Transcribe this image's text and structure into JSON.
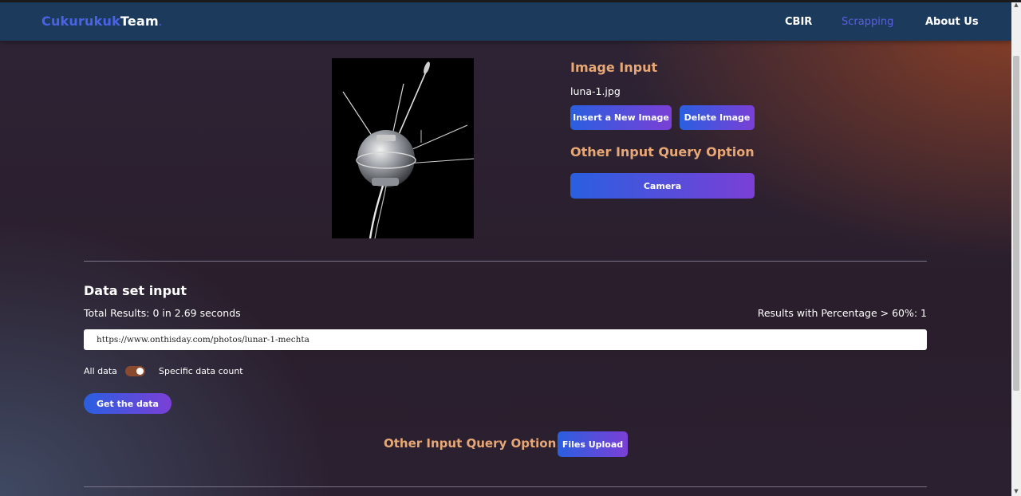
{
  "nav": {
    "brand_part1": "Cukurukuk",
    "brand_part2": "Team",
    "brand_dot": ".",
    "links": [
      {
        "label": "CBIR",
        "active": false
      },
      {
        "label": "Scrapping",
        "active": true
      },
      {
        "label": "About Us",
        "active": false
      }
    ]
  },
  "image_input": {
    "title": "Image Input",
    "file_name": "luna-1.jpg",
    "insert_button": "Insert a New Image",
    "delete_button": "Delete Image",
    "other_title": "Other Input Query Option",
    "camera_button": "Camera"
  },
  "dataset": {
    "title": "Data set input",
    "total_results": "Total Results: 0 in 2.69 seconds",
    "percentage_results": "Results with Percentage > 60%: 1",
    "url_value": "https://www.onthisday.com/photos/lunar-1-mechta",
    "toggle_left_label": "All data",
    "toggle_right_label": "Specific data count",
    "get_button": "Get the data",
    "other_label": "Other Input Query Option:",
    "files_button": "Files Upload"
  },
  "colors": {
    "accent_start": "#2a5fe0",
    "accent_end": "#7b3fd6",
    "heading": "#e7a876",
    "navbar": "#1c3a5c"
  }
}
